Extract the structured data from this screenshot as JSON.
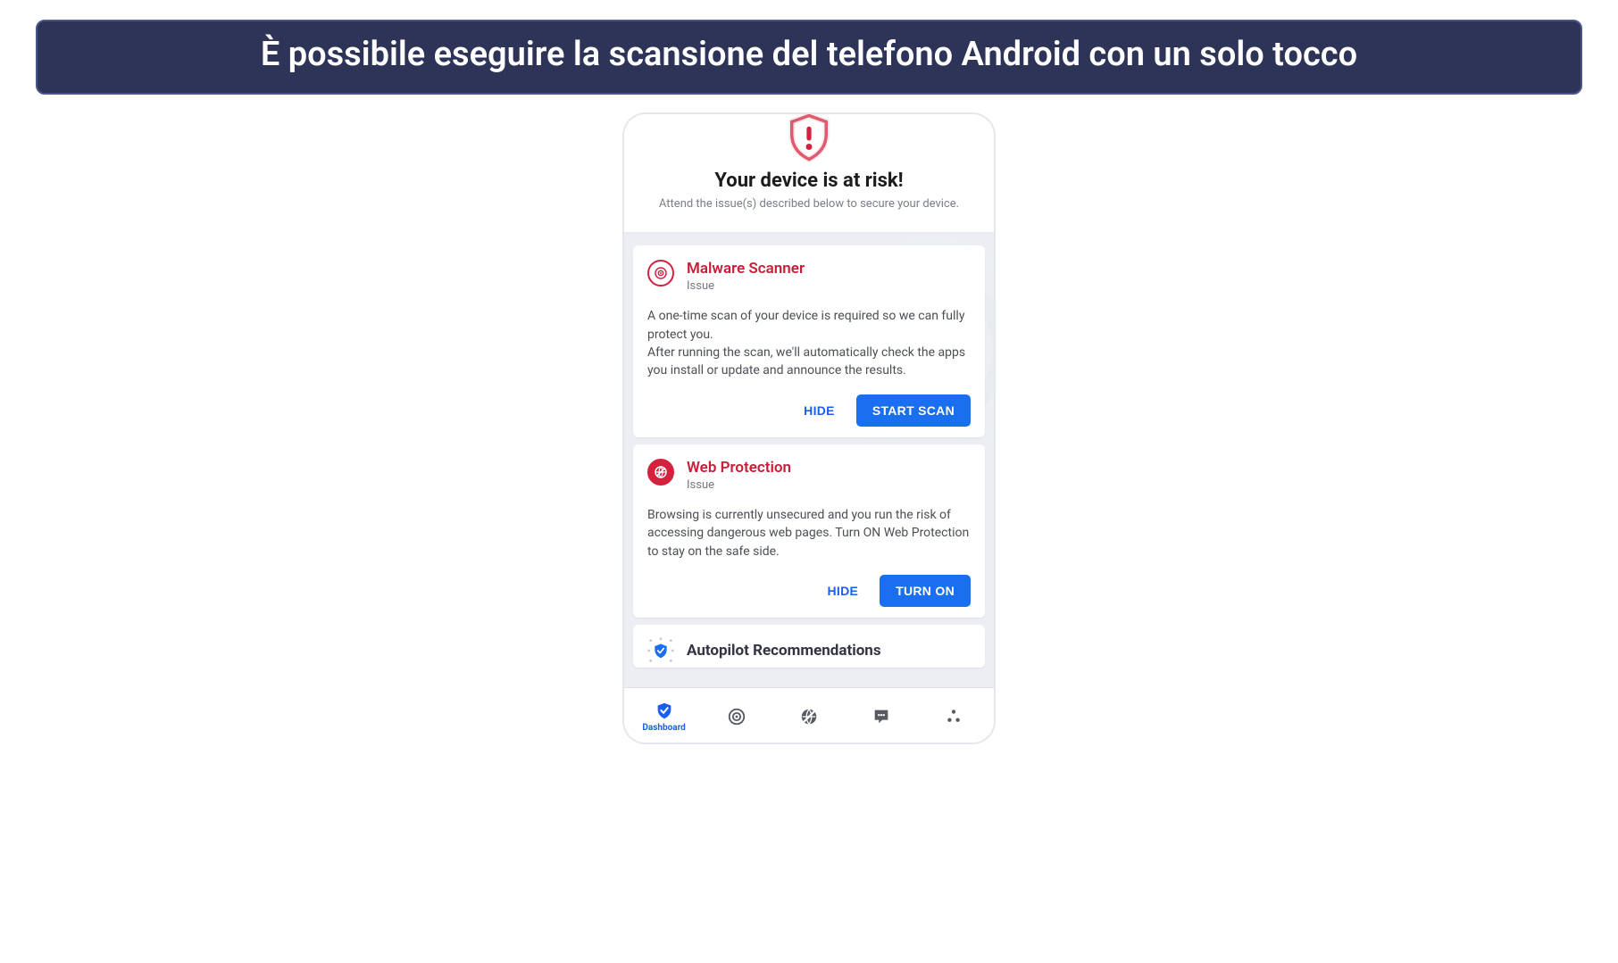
{
  "caption": "È possibile eseguire la scansione del telefono Android con un solo tocco",
  "risk": {
    "title": "Your device is at risk!",
    "subtitle": "Attend the issue(s) described below to secure your device."
  },
  "cards": [
    {
      "title": "Malware Scanner",
      "sub": "Issue",
      "body1": "A one-time scan of your device is required so we can fully protect you.",
      "body2": "After running the scan, we'll automatically check the apps you install or update and announce the results.",
      "hide": "HIDE",
      "action": "START SCAN"
    },
    {
      "title": "Web Protection",
      "sub": "Issue",
      "body1": "Browsing is currently unsecured and you run the risk of accessing dangerous web pages. Turn ON Web Protection to stay on the safe side.",
      "body2": "",
      "hide": "HIDE",
      "action": "TURN ON"
    }
  ],
  "autopilot": {
    "title": "Autopilot Recommendations"
  },
  "nav": {
    "dashboard": "Dashboard"
  }
}
